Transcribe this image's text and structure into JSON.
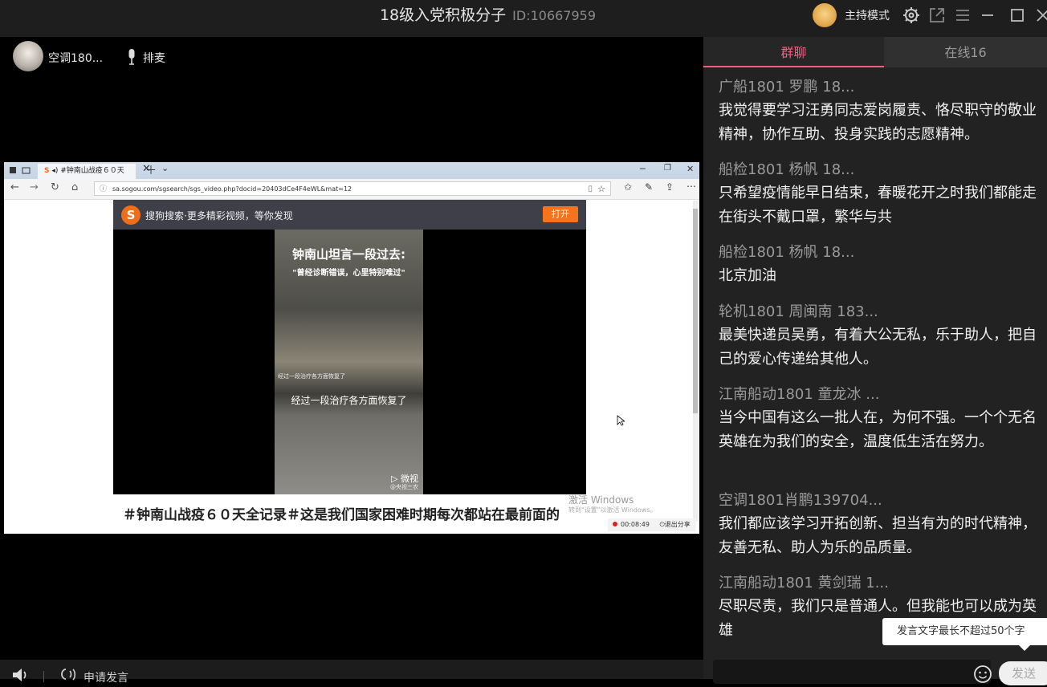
{
  "header": {
    "room_name": "18级入党积极分子",
    "room_id": "ID:10667959",
    "host_mode": "主持模式",
    "icons": [
      "avatar",
      "gear-icon",
      "popout-icon",
      "menu-icon",
      "minimize-icon",
      "maximize-icon",
      "close-icon"
    ]
  },
  "stage": {
    "speaker_name": "空调180...",
    "queue_label": "排麦",
    "shared_screen": {
      "tab_title": "#钟南山战疫６０天",
      "url": "sa.sogou.com/sgsearch/sgs_video.php?docid=20403dCe4F4eWL&mat=12",
      "sogou_text": "搜狗搜索·更多精彩视频，等你发现",
      "open_label": "打开",
      "video_title": "钟南山坦言一段过去:",
      "video_subtitle": "\"曾经诊断错误，心里特别难过\"",
      "video_small_caption": "经过一段治疗各方面恢复了",
      "video_caption": "经过一段治疗各方面恢复了",
      "video_watermark": "微视",
      "video_watermark_sub": "@央视三农",
      "article_title": "＃钟南山战疫６０天全记录＃这是我们国家困难时期每次都站在最前面的",
      "activate_windows": "激活 Windows",
      "activate_windows_sub": "转到\"设置\"以激活 Windows。",
      "record_time": "00:08:49",
      "exit_share": "退出分享"
    }
  },
  "bottom": {
    "apply_label": "申请发言"
  },
  "chat": {
    "tabs": [
      {
        "label": "群聊",
        "active": true
      },
      {
        "label": "在线16",
        "active": false
      }
    ],
    "messages": [
      {
        "sender": "广船1801  罗鹏  18...",
        "text": "我觉得要学习汪勇同志爱岗履责、恪尽职守的敬业精神，协作互助、投身实践的志愿精神。"
      },
      {
        "sender": "船检1801  杨帆  18...",
        "text": "只希望疫情能早日结束，春暖花开之时我们都能走在街头不戴口罩，繁华与共"
      },
      {
        "sender": "船检1801  杨帆  18...",
        "text": "北京加油"
      },
      {
        "sender": "轮机1801 周闽南 183...",
        "text": "最美快递员吴勇，有着大公无私，乐于助人，把自己的爱心传递给其他人。"
      },
      {
        "sender": "江南船动1801 童龙冰  ...",
        "text": "当今中国有这么一批人在，为何不强。一个个无名英雄在为我们的安全，温度低生活在努力。"
      },
      {
        "sender": "空调1801肖鹏139704...",
        "text": "我们都应该学习开拓创新、担当有为的时代精神，友善无私、助人为乐的品质量。"
      },
      {
        "sender": "江南船动1801 黄剑瑞 1...",
        "text": "尽职尽责，我们只是普通人。但我能也可以成为英雄"
      }
    ],
    "tooltip": "发言文字最长不超过50个字",
    "send_label": "发送"
  },
  "colors": {
    "accent": "#f06080",
    "panel_bg": "#222222",
    "titlebar_bg": "#1e1e1e"
  }
}
